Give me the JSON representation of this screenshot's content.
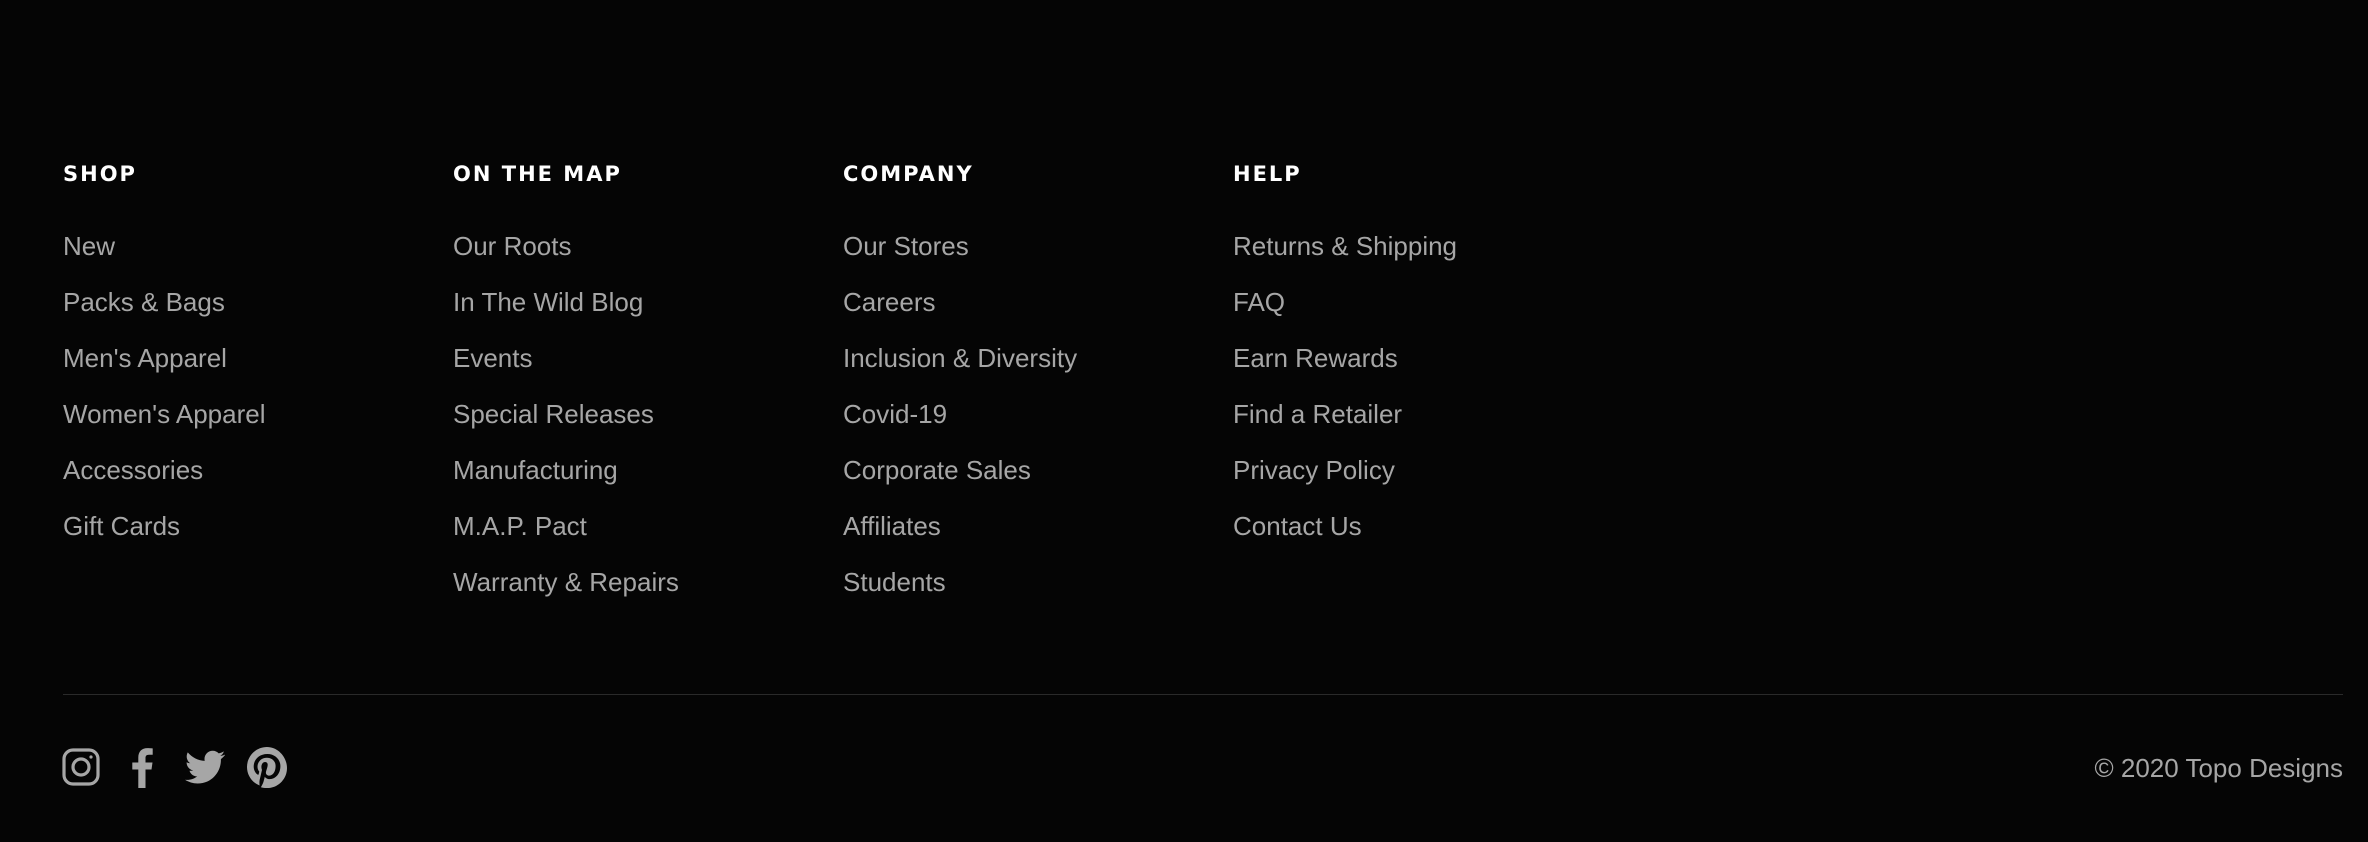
{
  "columns": [
    {
      "heading": "SHOP",
      "links": [
        "New",
        "Packs & Bags",
        "Men's Apparel",
        "Women's Apparel",
        "Accessories",
        "Gift Cards"
      ]
    },
    {
      "heading": "ON THE MAP",
      "links": [
        "Our Roots",
        "In The Wild Blog",
        "Events",
        "Special Releases",
        "Manufacturing",
        "M.A.P. Pact",
        "Warranty & Repairs"
      ]
    },
    {
      "heading": "COMPANY",
      "links": [
        "Our Stores",
        "Careers",
        "Inclusion & Diversity",
        "Covid-19",
        "Corporate Sales",
        "Affiliates",
        "Students"
      ]
    },
    {
      "heading": "HELP",
      "links": [
        "Returns & Shipping",
        "FAQ",
        "Earn Rewards",
        "Find a Retailer",
        "Privacy Policy",
        "Contact Us"
      ]
    }
  ],
  "social": [
    "instagram-icon",
    "facebook-icon",
    "twitter-icon",
    "pinterest-icon"
  ],
  "copyright": "© 2020 Topo Designs",
  "colors": {
    "background": "#050505",
    "heading": "#ffffff",
    "link": "#a6a6a6",
    "divider": "#2a2a2a"
  }
}
